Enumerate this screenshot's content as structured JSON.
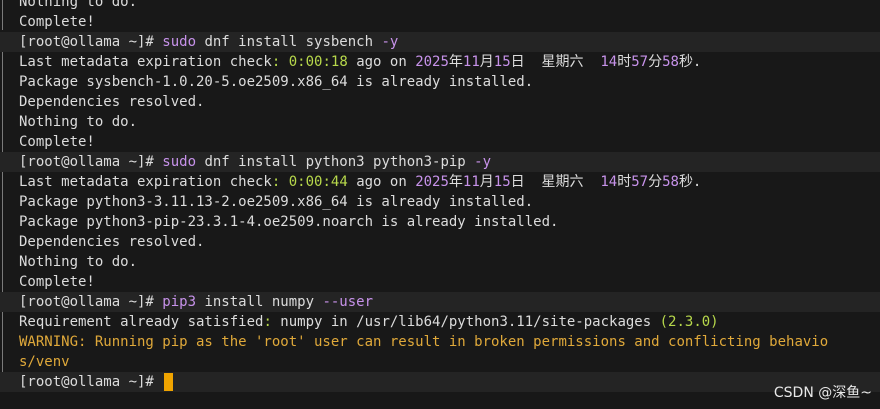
{
  "colors": {
    "default": "#dcdcdc",
    "cmd": "#c792ea",
    "green": "#b7d84b",
    "num": "#c792ea",
    "warn": "#e0a93a",
    "cursor": "#f0a400"
  },
  "lines": [
    {
      "prompt": false,
      "segments": [
        {
          "text": "Nothing to do.",
          "color": "default"
        }
      ]
    },
    {
      "prompt": false,
      "segments": [
        {
          "text": "Complete!",
          "color": "default"
        }
      ]
    },
    {
      "prompt": true,
      "segments": [
        {
          "text": "[root@ollama ~]# ",
          "color": "default"
        },
        {
          "text": "sudo",
          "color": "cmd"
        },
        {
          "text": " dnf install sysbench ",
          "color": "default"
        },
        {
          "text": "-y",
          "color": "cmd"
        }
      ]
    },
    {
      "prompt": false,
      "segments": [
        {
          "text": "Last metadata expiration check",
          "color": "default"
        },
        {
          "text": ":",
          "color": "green"
        },
        {
          "text": " ",
          "color": "default"
        },
        {
          "text": "0:00:18",
          "color": "green"
        },
        {
          "text": " ago on ",
          "color": "default"
        },
        {
          "text": "2025",
          "color": "num"
        },
        {
          "text": "年",
          "color": "default"
        },
        {
          "text": "11",
          "color": "num"
        },
        {
          "text": "月",
          "color": "default"
        },
        {
          "text": "15",
          "color": "num"
        },
        {
          "text": "日  星期六  ",
          "color": "default"
        },
        {
          "text": "14",
          "color": "num"
        },
        {
          "text": "时",
          "color": "default"
        },
        {
          "text": "57",
          "color": "num"
        },
        {
          "text": "分",
          "color": "default"
        },
        {
          "text": "58",
          "color": "num"
        },
        {
          "text": "秒.",
          "color": "default"
        }
      ]
    },
    {
      "prompt": false,
      "segments": [
        {
          "text": "Package sysbench-1.0.20-5.oe2509.x86_64 is already installed.",
          "color": "default"
        }
      ]
    },
    {
      "prompt": false,
      "segments": [
        {
          "text": "Dependencies resolved.",
          "color": "default"
        }
      ]
    },
    {
      "prompt": false,
      "segments": [
        {
          "text": "Nothing to do.",
          "color": "default"
        }
      ]
    },
    {
      "prompt": false,
      "segments": [
        {
          "text": "Complete!",
          "color": "default"
        }
      ]
    },
    {
      "prompt": true,
      "segments": [
        {
          "text": "[root@ollama ~]# ",
          "color": "default"
        },
        {
          "text": "sudo",
          "color": "cmd"
        },
        {
          "text": " dnf install python3 python3-pip ",
          "color": "default"
        },
        {
          "text": "-y",
          "color": "cmd"
        }
      ]
    },
    {
      "prompt": false,
      "segments": [
        {
          "text": "Last metadata expiration check",
          "color": "default"
        },
        {
          "text": ":",
          "color": "green"
        },
        {
          "text": " ",
          "color": "default"
        },
        {
          "text": "0:00:44",
          "color": "green"
        },
        {
          "text": " ago on ",
          "color": "default"
        },
        {
          "text": "2025",
          "color": "num"
        },
        {
          "text": "年",
          "color": "default"
        },
        {
          "text": "11",
          "color": "num"
        },
        {
          "text": "月",
          "color": "default"
        },
        {
          "text": "15",
          "color": "num"
        },
        {
          "text": "日  星期六  ",
          "color": "default"
        },
        {
          "text": "14",
          "color": "num"
        },
        {
          "text": "时",
          "color": "default"
        },
        {
          "text": "57",
          "color": "num"
        },
        {
          "text": "分",
          "color": "default"
        },
        {
          "text": "58",
          "color": "num"
        },
        {
          "text": "秒.",
          "color": "default"
        }
      ]
    },
    {
      "prompt": false,
      "segments": [
        {
          "text": "Package python3-3.11.13-2.oe2509.x86_64 is already installed.",
          "color": "default"
        }
      ]
    },
    {
      "prompt": false,
      "segments": [
        {
          "text": "Package python3-pip-23.3.1-4.oe2509.noarch is already installed.",
          "color": "default"
        }
      ]
    },
    {
      "prompt": false,
      "segments": [
        {
          "text": "Dependencies resolved.",
          "color": "default"
        }
      ]
    },
    {
      "prompt": false,
      "segments": [
        {
          "text": "Nothing to do.",
          "color": "default"
        }
      ]
    },
    {
      "prompt": false,
      "segments": [
        {
          "text": "Complete!",
          "color": "default"
        }
      ]
    },
    {
      "prompt": true,
      "segments": [
        {
          "text": "[root@ollama ~]# ",
          "color": "default"
        },
        {
          "text": "pip3",
          "color": "cmd"
        },
        {
          "text": " install numpy ",
          "color": "default"
        },
        {
          "text": "--user",
          "color": "cmd"
        }
      ]
    },
    {
      "prompt": false,
      "segments": [
        {
          "text": "Requirement already satisfied",
          "color": "default"
        },
        {
          "text": ":",
          "color": "green"
        },
        {
          "text": " numpy in /usr/lib64/python3.11/site-packages ",
          "color": "default"
        },
        {
          "text": "(2.3.0)",
          "color": "green"
        }
      ]
    },
    {
      "prompt": false,
      "segments": [
        {
          "text": "WARNING: Running pip as the 'root' user can result in broken permissions and conflicting behavio",
          "color": "warn"
        }
      ]
    },
    {
      "prompt": false,
      "segments": [
        {
          "text": "s/venv",
          "color": "warn"
        }
      ]
    },
    {
      "prompt": true,
      "cursor": true,
      "segments": [
        {
          "text": "[root@ollama ~]# ",
          "color": "default"
        }
      ]
    }
  ],
  "watermark": "CSDN @深鱼~"
}
